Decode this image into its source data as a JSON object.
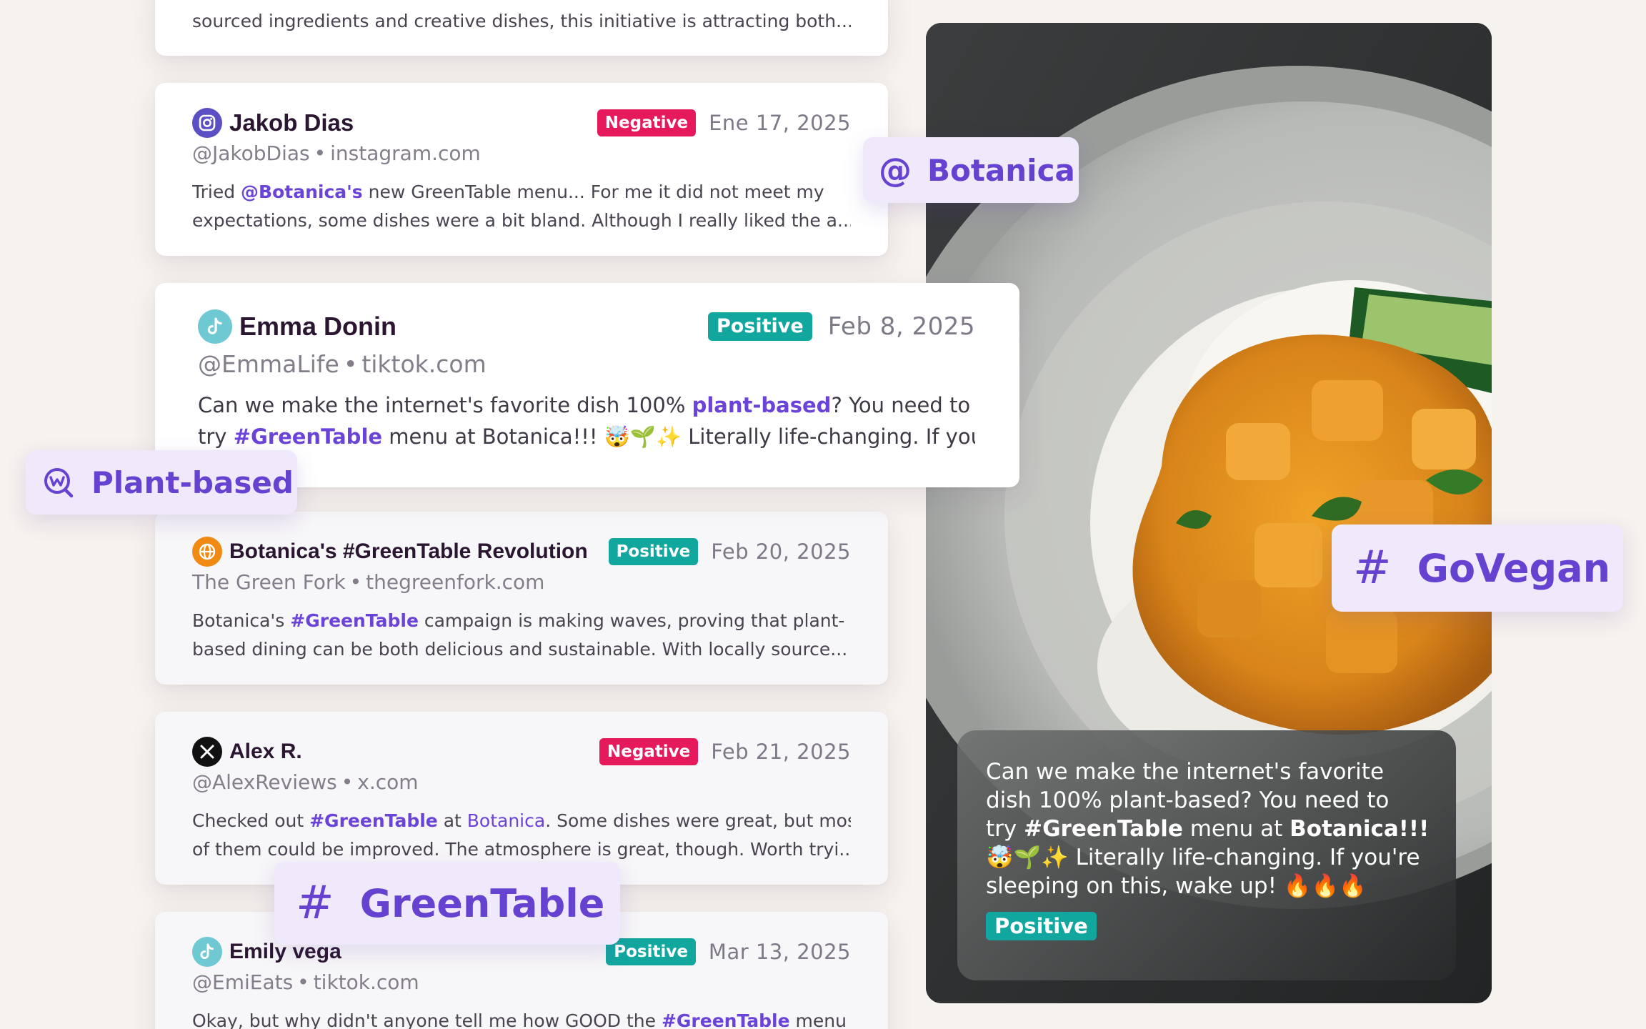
{
  "cards": [
    {
      "partial_text": "sourced ingredients and creative dishes, this initiative is attracting both..."
    },
    {
      "author": "Jakob Dias",
      "badge": "Negative",
      "date": "Ene 17, 2025",
      "handle": "@JakobDias",
      "source": "instagram.com",
      "icon": "instagram-icon",
      "text_a": "Tried ",
      "text_tag": "@Botanica's",
      "text_b": " new GreenTable menu... For me it did not meet my",
      "text_line2": "expectations, some dishes were a bit bland. Although I really liked the a..."
    },
    {
      "author": "Emma Donin",
      "badge": "Positive",
      "date": "Feb 8, 2025",
      "handle": "@EmmaLife",
      "source": "tiktok.com",
      "icon": "tiktok-icon",
      "text_a": "Can we make the internet's favorite dish 100% ",
      "text_tag": "plant-based",
      "text_b": "? You need to",
      "text_c": "try ",
      "text_tag2": "#GreenTable",
      "text_d": " menu at Botanica!!! 🤯🌱✨ Literally life-changing. If you..."
    },
    {
      "author": "Botanica's #GreenTable Revolution",
      "badge": "Positive",
      "date": "Feb 20, 2025",
      "handle": "The Green Fork",
      "source": "thegreenfork.com",
      "icon": "globe-icon",
      "text_a": "Botanica's ",
      "text_tag": "#GreenTable",
      "text_b": " campaign is making waves, proving that plant-",
      "text_line2": "based dining can be both delicious and sustainable. With locally source..."
    },
    {
      "author": "Alex R.",
      "badge": "Negative",
      "date": "Feb 21, 2025",
      "handle": "@AlexReviews",
      "source": "x.com",
      "icon": "x-icon",
      "text_a": "Checked out ",
      "text_tag": "#GreenTable",
      "text_b": " at ",
      "text_tag2": "Botanica",
      "text_c": ". Some dishes were great, but most",
      "text_line2": "of them could be improved. The atmosphere is great, though. Worth tryi..."
    },
    {
      "author": "Emily vega",
      "badge": "Positive",
      "date": "Mar 13, 2025",
      "handle": "@EmiEats",
      "source": "tiktok.com",
      "icon": "tiktok-icon",
      "text_a": "Okay, but why didn't anyone tell me how GOOD the ",
      "text_tag": "#GreenTable",
      "text_b": " menu at"
    }
  ],
  "chips": {
    "botanica": {
      "symbol": "@",
      "label": "Botanica"
    },
    "plant_based": {
      "label": "Plant-based",
      "icon": "keyword-search-icon"
    },
    "govegan": {
      "symbol": "#",
      "label": "GoVegan"
    },
    "greentable": {
      "symbol": "#",
      "label": "GreenTable"
    }
  },
  "photo_overlay": {
    "line1": "Can we make the internet's favorite",
    "line2": "dish 100% plant-based? You need to",
    "line3_a": "try ",
    "line3_b": "#GreenTable",
    "line3_c": " menu at ",
    "line3_d": "Botanica!!!",
    "line4": "🤯🌱✨ Literally life-changing. If you're",
    "line5": "sleeping on this, wake up! 🔥🔥🔥",
    "badge": "Positive"
  },
  "colors": {
    "negative": "#e5195c",
    "positive": "#12a79e",
    "accent": "#6a43d8",
    "chip_bg": "#efe9fb"
  }
}
